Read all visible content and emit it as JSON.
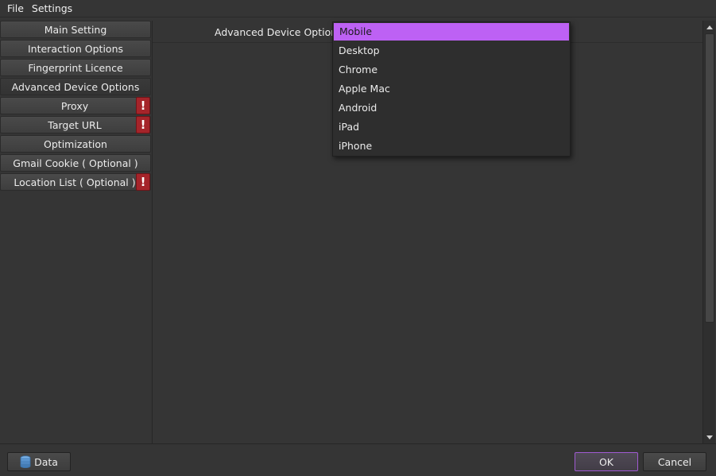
{
  "menu": {
    "items": [
      "File",
      "Settings"
    ]
  },
  "sidebar": {
    "items": [
      {
        "label": "Main Setting",
        "warning": false
      },
      {
        "label": "Interaction Options",
        "warning": false
      },
      {
        "label": "Fingerprint Licence",
        "warning": false
      },
      {
        "label": "Advanced Device Options",
        "warning": false,
        "active": true
      },
      {
        "label": "Proxy",
        "warning": true
      },
      {
        "label": "Target URL",
        "warning": true
      },
      {
        "label": "Optimization",
        "warning": false
      },
      {
        "label": "Gmail Cookie ( Optional )",
        "warning": false
      },
      {
        "label": "Location List ( Optional )",
        "warning": true
      }
    ],
    "warning_glyph": "!"
  },
  "main": {
    "field_label": "Advanced Device Options",
    "dropdown": {
      "selected": "Mobile",
      "options": [
        "Mobile",
        "Desktop",
        "Chrome",
        "Apple Mac",
        "Android",
        "iPad",
        "iPhone"
      ]
    }
  },
  "footer": {
    "data_label": "Data",
    "ok_label": "OK",
    "cancel_label": "Cancel"
  },
  "icons": {
    "data": "database-icon",
    "warning": "exclamation-icon",
    "scroll_up": "chevron-up-icon",
    "scroll_down": "chevron-down-icon"
  },
  "colors": {
    "accent": "#bd61f4",
    "warning": "#a5242a",
    "background": "#353535"
  }
}
